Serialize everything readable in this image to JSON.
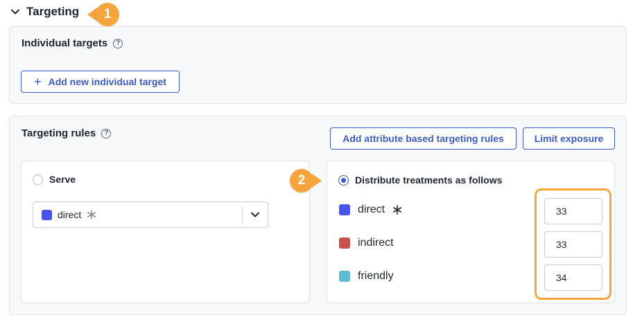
{
  "section": {
    "title": "Targeting"
  },
  "callouts": {
    "first": "1",
    "second": "2"
  },
  "individual_targets": {
    "title": "Individual targets",
    "help_icon": "?",
    "add_button_label": "Add new individual target"
  },
  "targeting_rules": {
    "title": "Targeting rules",
    "help_icon": "?",
    "add_attribute_rules_label": "Add attribute based targeting rules",
    "limit_exposure_label": "Limit exposure",
    "serve": {
      "label": "Serve",
      "selected": "direct",
      "selected_color": "#4b52e8"
    },
    "distribute": {
      "label": "Distribute treatments as follows",
      "treatments": [
        {
          "name": "direct",
          "color": "#4b52e8",
          "value": "33",
          "default_marker": true
        },
        {
          "name": "indirect",
          "color": "#c9504b",
          "value": "33",
          "default_marker": false
        },
        {
          "name": "friendly",
          "color": "#5ebcd0",
          "value": "34",
          "default_marker": false
        }
      ]
    }
  },
  "colors": {
    "accent": "#3a5bc7",
    "callout": "#f5a53c"
  }
}
